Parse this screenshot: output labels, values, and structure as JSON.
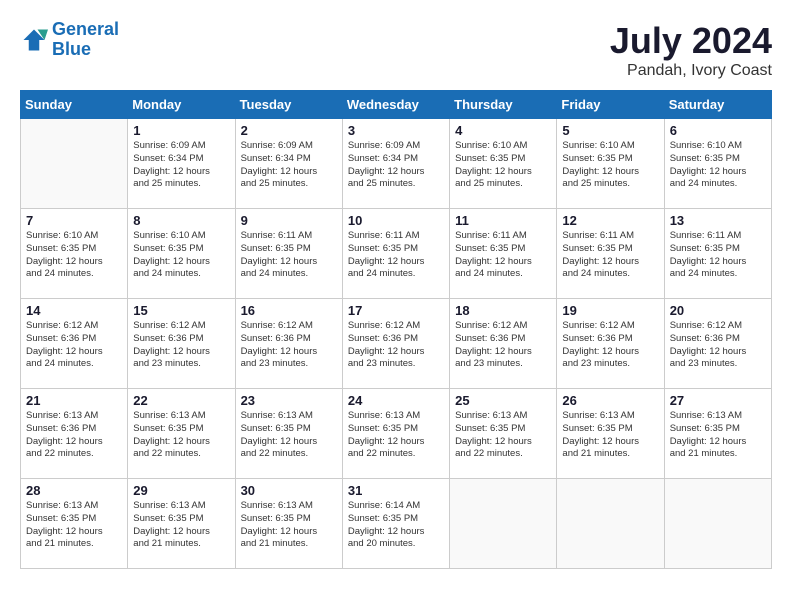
{
  "logo": {
    "line1": "General",
    "line2": "Blue"
  },
  "title": "July 2024",
  "subtitle": "Pandah, Ivory Coast",
  "days_header": [
    "Sunday",
    "Monday",
    "Tuesday",
    "Wednesday",
    "Thursday",
    "Friday",
    "Saturday"
  ],
  "weeks": [
    [
      {
        "day": "",
        "info": ""
      },
      {
        "day": "1",
        "info": "Sunrise: 6:09 AM\nSunset: 6:34 PM\nDaylight: 12 hours\nand 25 minutes."
      },
      {
        "day": "2",
        "info": "Sunrise: 6:09 AM\nSunset: 6:34 PM\nDaylight: 12 hours\nand 25 minutes."
      },
      {
        "day": "3",
        "info": "Sunrise: 6:09 AM\nSunset: 6:34 PM\nDaylight: 12 hours\nand 25 minutes."
      },
      {
        "day": "4",
        "info": "Sunrise: 6:10 AM\nSunset: 6:35 PM\nDaylight: 12 hours\nand 25 minutes."
      },
      {
        "day": "5",
        "info": "Sunrise: 6:10 AM\nSunset: 6:35 PM\nDaylight: 12 hours\nand 25 minutes."
      },
      {
        "day": "6",
        "info": "Sunrise: 6:10 AM\nSunset: 6:35 PM\nDaylight: 12 hours\nand 24 minutes."
      }
    ],
    [
      {
        "day": "7",
        "info": "Sunrise: 6:10 AM\nSunset: 6:35 PM\nDaylight: 12 hours\nand 24 minutes."
      },
      {
        "day": "8",
        "info": "Sunrise: 6:10 AM\nSunset: 6:35 PM\nDaylight: 12 hours\nand 24 minutes."
      },
      {
        "day": "9",
        "info": "Sunrise: 6:11 AM\nSunset: 6:35 PM\nDaylight: 12 hours\nand 24 minutes."
      },
      {
        "day": "10",
        "info": "Sunrise: 6:11 AM\nSunset: 6:35 PM\nDaylight: 12 hours\nand 24 minutes."
      },
      {
        "day": "11",
        "info": "Sunrise: 6:11 AM\nSunset: 6:35 PM\nDaylight: 12 hours\nand 24 minutes."
      },
      {
        "day": "12",
        "info": "Sunrise: 6:11 AM\nSunset: 6:35 PM\nDaylight: 12 hours\nand 24 minutes."
      },
      {
        "day": "13",
        "info": "Sunrise: 6:11 AM\nSunset: 6:35 PM\nDaylight: 12 hours\nand 24 minutes."
      }
    ],
    [
      {
        "day": "14",
        "info": "Sunrise: 6:12 AM\nSunset: 6:36 PM\nDaylight: 12 hours\nand 24 minutes."
      },
      {
        "day": "15",
        "info": "Sunrise: 6:12 AM\nSunset: 6:36 PM\nDaylight: 12 hours\nand 23 minutes."
      },
      {
        "day": "16",
        "info": "Sunrise: 6:12 AM\nSunset: 6:36 PM\nDaylight: 12 hours\nand 23 minutes."
      },
      {
        "day": "17",
        "info": "Sunrise: 6:12 AM\nSunset: 6:36 PM\nDaylight: 12 hours\nand 23 minutes."
      },
      {
        "day": "18",
        "info": "Sunrise: 6:12 AM\nSunset: 6:36 PM\nDaylight: 12 hours\nand 23 minutes."
      },
      {
        "day": "19",
        "info": "Sunrise: 6:12 AM\nSunset: 6:36 PM\nDaylight: 12 hours\nand 23 minutes."
      },
      {
        "day": "20",
        "info": "Sunrise: 6:12 AM\nSunset: 6:36 PM\nDaylight: 12 hours\nand 23 minutes."
      }
    ],
    [
      {
        "day": "21",
        "info": "Sunrise: 6:13 AM\nSunset: 6:36 PM\nDaylight: 12 hours\nand 22 minutes."
      },
      {
        "day": "22",
        "info": "Sunrise: 6:13 AM\nSunset: 6:35 PM\nDaylight: 12 hours\nand 22 minutes."
      },
      {
        "day": "23",
        "info": "Sunrise: 6:13 AM\nSunset: 6:35 PM\nDaylight: 12 hours\nand 22 minutes."
      },
      {
        "day": "24",
        "info": "Sunrise: 6:13 AM\nSunset: 6:35 PM\nDaylight: 12 hours\nand 22 minutes."
      },
      {
        "day": "25",
        "info": "Sunrise: 6:13 AM\nSunset: 6:35 PM\nDaylight: 12 hours\nand 22 minutes."
      },
      {
        "day": "26",
        "info": "Sunrise: 6:13 AM\nSunset: 6:35 PM\nDaylight: 12 hours\nand 21 minutes."
      },
      {
        "day": "27",
        "info": "Sunrise: 6:13 AM\nSunset: 6:35 PM\nDaylight: 12 hours\nand 21 minutes."
      }
    ],
    [
      {
        "day": "28",
        "info": "Sunrise: 6:13 AM\nSunset: 6:35 PM\nDaylight: 12 hours\nand 21 minutes."
      },
      {
        "day": "29",
        "info": "Sunrise: 6:13 AM\nSunset: 6:35 PM\nDaylight: 12 hours\nand 21 minutes."
      },
      {
        "day": "30",
        "info": "Sunrise: 6:13 AM\nSunset: 6:35 PM\nDaylight: 12 hours\nand 21 minutes."
      },
      {
        "day": "31",
        "info": "Sunrise: 6:14 AM\nSunset: 6:35 PM\nDaylight: 12 hours\nand 20 minutes."
      },
      {
        "day": "",
        "info": ""
      },
      {
        "day": "",
        "info": ""
      },
      {
        "day": "",
        "info": ""
      }
    ]
  ]
}
